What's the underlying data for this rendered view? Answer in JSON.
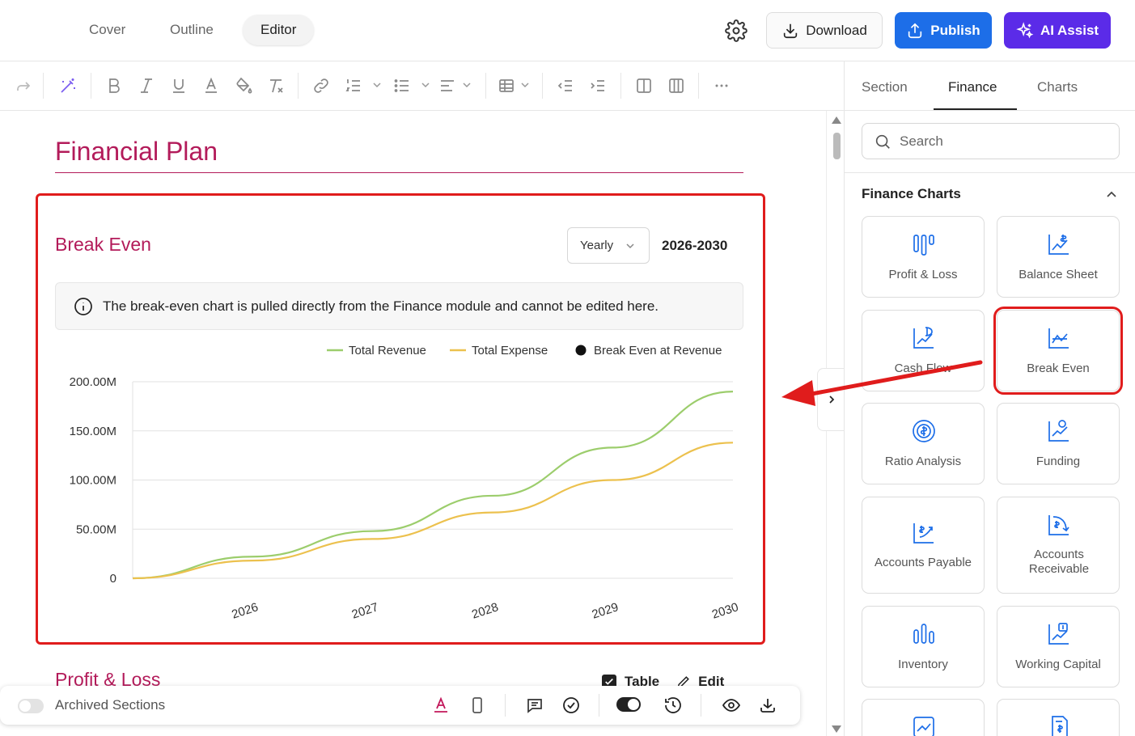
{
  "header": {
    "tabs": [
      {
        "label": "Cover"
      },
      {
        "label": "Outline"
      },
      {
        "label": "Editor"
      }
    ],
    "download_label": "Download",
    "publish_label": "Publish",
    "ai_label": "AI Assist",
    "colors": {
      "publish": "#1d6ee8",
      "ai": "#5b2be8",
      "accent": "#b31b5a"
    }
  },
  "toolbar": {
    "icons": [
      "redo-icon",
      "magic-icon",
      "bold-icon",
      "italic-icon",
      "underline-icon",
      "font-color-icon",
      "fill-color-icon",
      "clear-format-icon",
      "link-icon",
      "ordered-list-icon",
      "bullet-list-icon",
      "align-icon",
      "table-icon",
      "outdent-icon",
      "indent-icon",
      "column-icon",
      "columns-icon",
      "more-icon"
    ]
  },
  "document": {
    "title": "Financial Plan",
    "break_even": {
      "title": "Break Even",
      "period_select": "Yearly",
      "range": "2026-2030",
      "info_text": "The break-even chart is pulled directly from the Finance module and cannot be edited here."
    },
    "profit_loss": {
      "title": "Profit & Loss",
      "table_label": "Table",
      "edit_label": "Edit"
    }
  },
  "chart_data": {
    "type": "line",
    "x": [
      "2026",
      "2027",
      "2028",
      "2029",
      "2030"
    ],
    "series": [
      {
        "name": "Total Revenue",
        "color": "#9ccd6c",
        "values": [
          0,
          22,
          48,
          84,
          133,
          190
        ]
      },
      {
        "name": "Total Expense",
        "color": "#ecc14e",
        "values": [
          0,
          18,
          40,
          67,
          100,
          138
        ]
      },
      {
        "name": "Break Even at Revenue",
        "color": "#111111",
        "values": []
      }
    ],
    "x_positions": [
      0,
      1,
      2,
      3,
      4,
      5
    ],
    "y_ticks": [
      "0",
      "50.00M",
      "100.00M",
      "150.00M",
      "200.00M"
    ],
    "ylim": [
      0,
      200
    ],
    "legend": "top-right",
    "grid": true
  },
  "bottom_bar": {
    "archived_label": "Archived Sections"
  },
  "right_panel": {
    "tabs": [
      {
        "label": "Section"
      },
      {
        "label": "Finance"
      },
      {
        "label": "Charts"
      }
    ],
    "search_placeholder": "Search",
    "section_title": "Finance Charts",
    "cards": [
      {
        "label": "Profit & Loss",
        "icon": "bar-chart-icon"
      },
      {
        "label": "Balance Sheet",
        "icon": "balance-chart-icon"
      },
      {
        "label": "Cash Flow",
        "icon": "cash-flow-icon"
      },
      {
        "label": "Break Even",
        "icon": "break-even-icon"
      },
      {
        "label": "Ratio Analysis",
        "icon": "ratio-icon"
      },
      {
        "label": "Funding",
        "icon": "funding-icon"
      },
      {
        "label": "Accounts Payable",
        "icon": "payable-icon"
      },
      {
        "label": "Accounts Receivable",
        "icon": "receivable-icon"
      },
      {
        "label": "Inventory",
        "icon": "inventory-icon"
      },
      {
        "label": "Working Capital",
        "icon": "working-capital-icon"
      }
    ]
  }
}
